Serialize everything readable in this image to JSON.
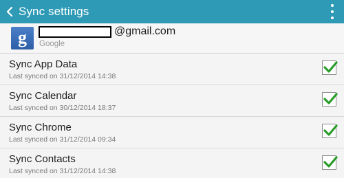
{
  "colors": {
    "action_bar": "#2f9ab6",
    "check_green": "#2a9d2a",
    "google_blue": "#3b6fb6"
  },
  "header": {
    "back_icon": "chevron-left-icon",
    "title": "Sync settings",
    "menu_icon": "overflow-menu-icon"
  },
  "account": {
    "logo_letter": "g",
    "email_suffix": "@gmail.com",
    "type": "Google"
  },
  "sync_items": [
    {
      "title": "Sync App Data",
      "subtitle": "Last synced on 31/12/2014 14:38",
      "checked": true
    },
    {
      "title": "Sync Calendar",
      "subtitle": "Last synced on 30/12/2014 18:37",
      "checked": true
    },
    {
      "title": "Sync Chrome",
      "subtitle": "Last synced on 31/12/2014 09:34",
      "checked": true
    },
    {
      "title": "Sync Contacts",
      "subtitle": "Last synced on 31/12/2014 14:38",
      "checked": true
    }
  ]
}
